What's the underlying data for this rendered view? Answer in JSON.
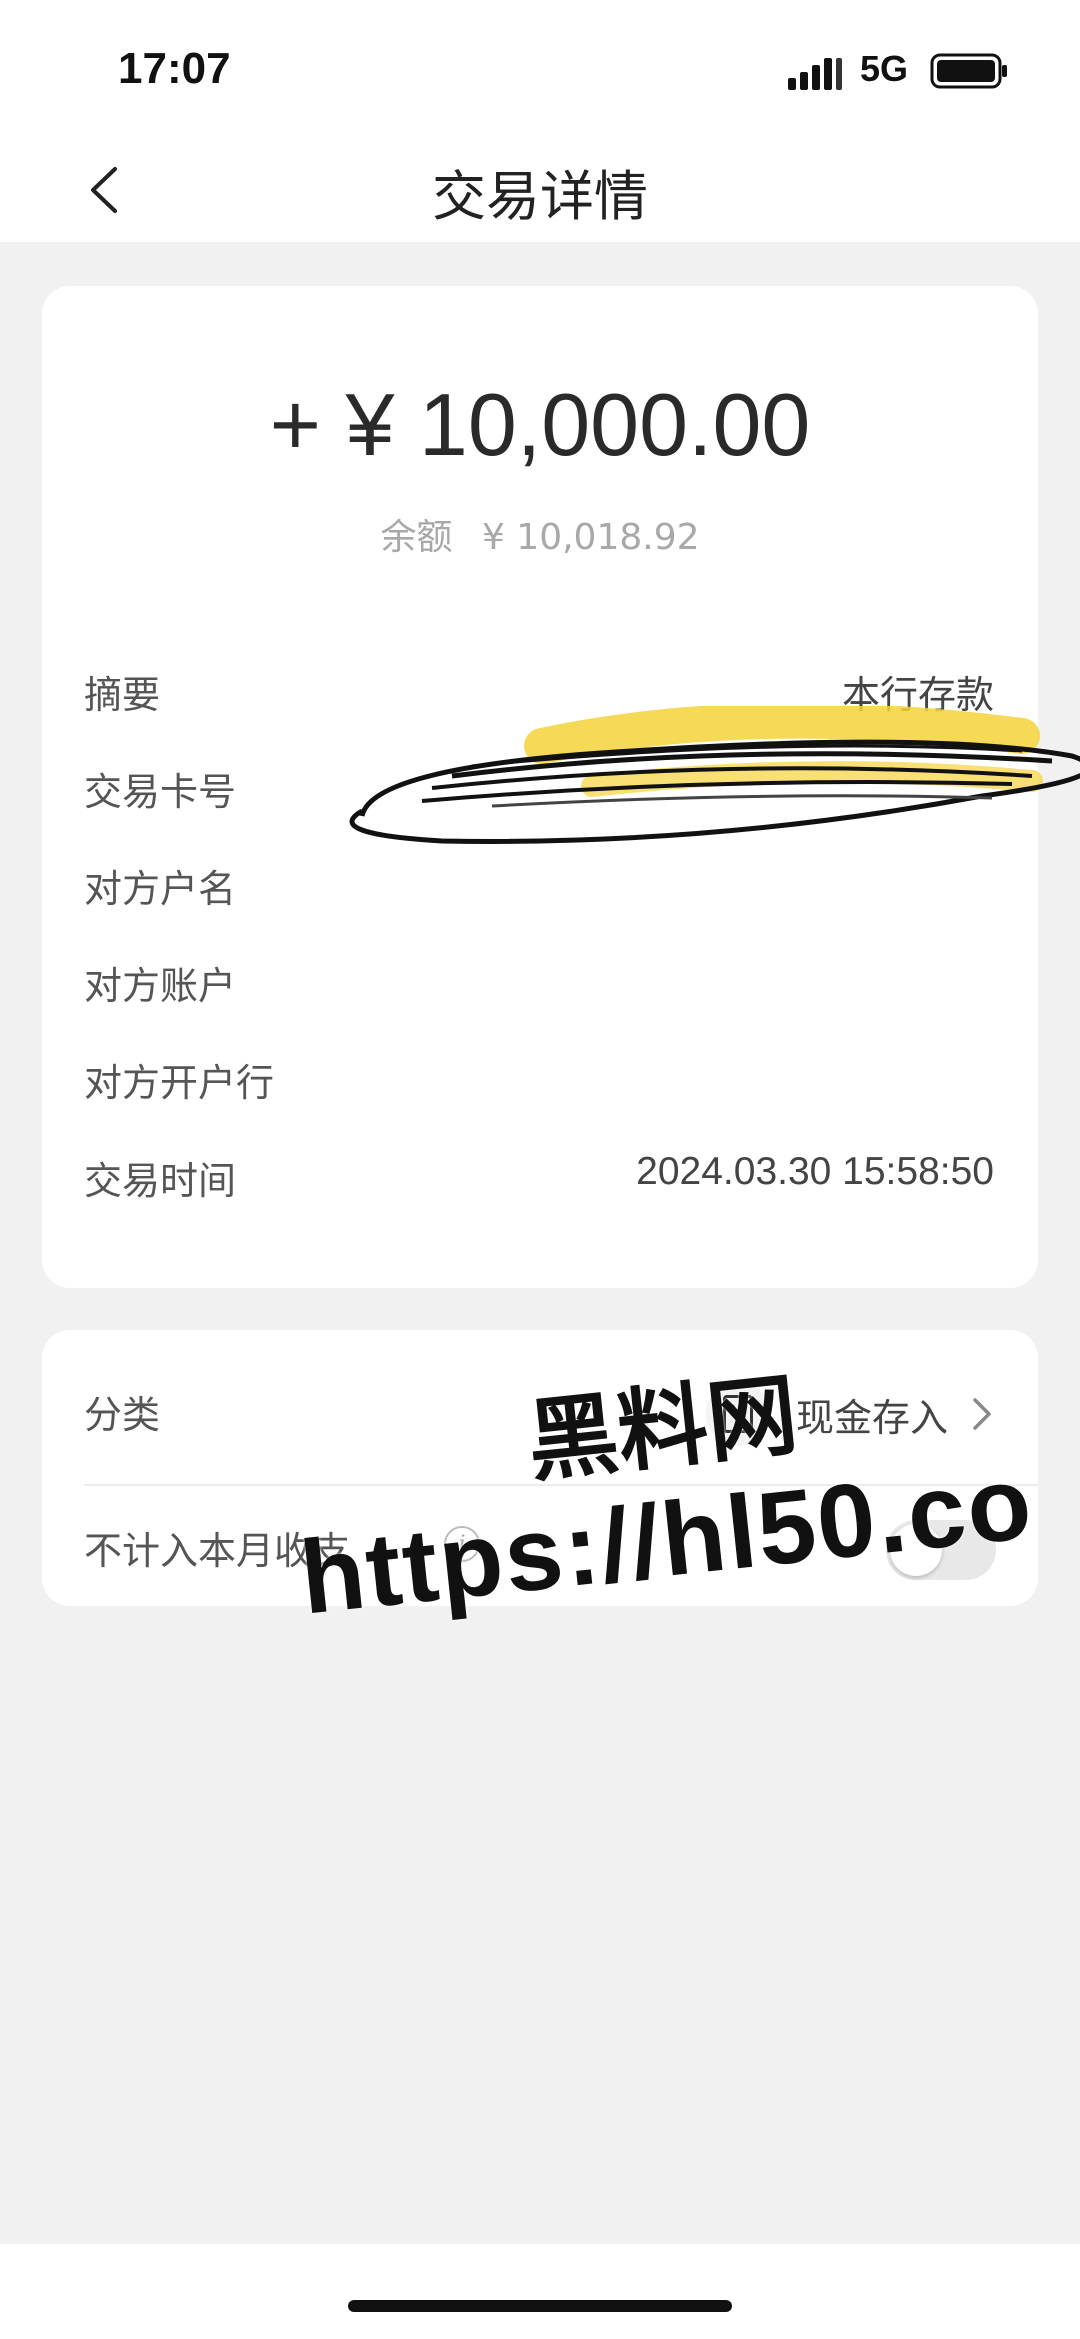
{
  "status_bar": {
    "time": "17:07",
    "network": "5G"
  },
  "nav": {
    "title": "交易详情"
  },
  "transaction": {
    "amount": "+ ¥ 10,000.00",
    "balance_label": "余额",
    "balance_value": "¥ 10,018.92"
  },
  "details": [
    {
      "key": "摘要",
      "value": "本行存款"
    },
    {
      "key": "交易卡号",
      "value": ""
    },
    {
      "key": "对方户名",
      "value": ""
    },
    {
      "key": "对方账户",
      "value": ""
    },
    {
      "key": "对方开户行",
      "value": ""
    },
    {
      "key": "交易时间",
      "value": "2024.03.30 15:58:50"
    }
  ],
  "category": {
    "label": "分类",
    "value": "现金存入",
    "icon_char": "¥"
  },
  "exclude": {
    "label": "不计入本月收支",
    "info_char": "i",
    "enabled": false
  },
  "watermark": {
    "line1": "黑料网",
    "line2": "https://hl50.co"
  },
  "colors": {
    "background": "#f1f1f1",
    "card": "#ffffff",
    "highlight": "#f5d33a"
  }
}
